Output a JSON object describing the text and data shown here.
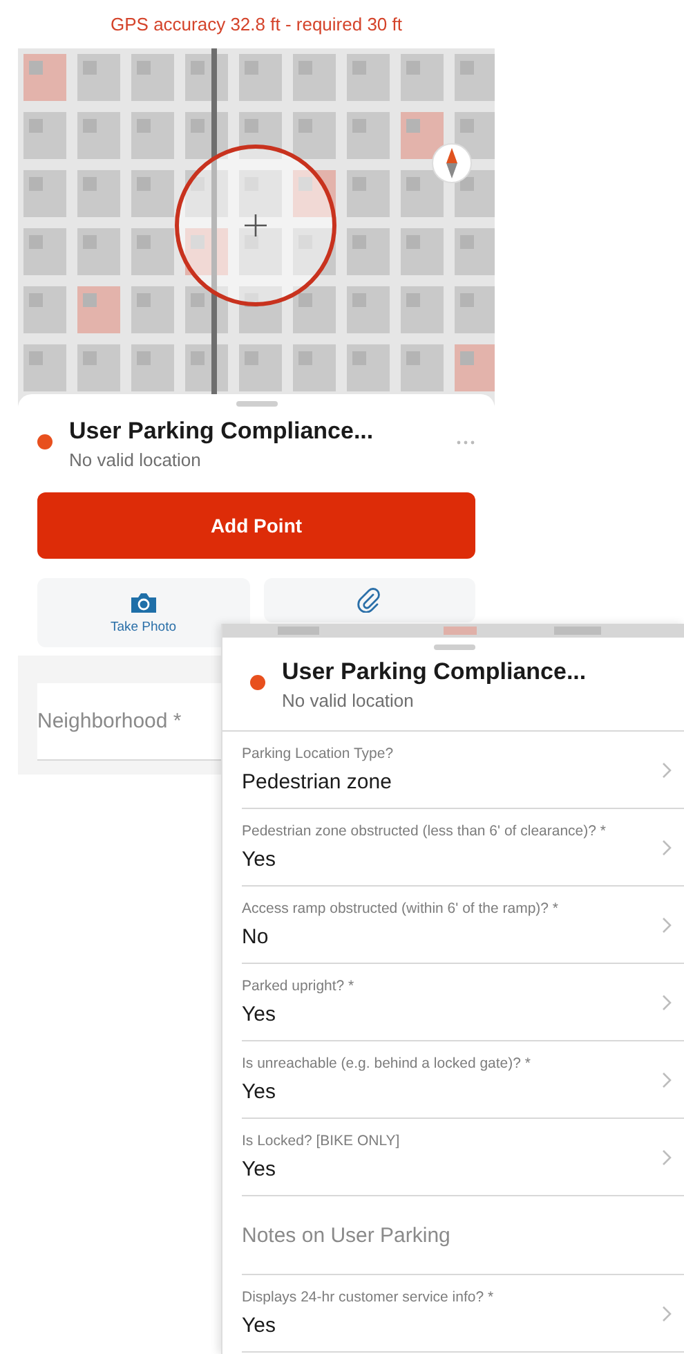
{
  "collect_screen": {
    "gps_banner": "GPS accuracy 32.8 ft - required 30 ft",
    "sheet": {
      "title": "User Parking Compliance...",
      "subtitle": "No valid location"
    },
    "add_button": "Add Point",
    "tiles": [
      {
        "kind": "camera",
        "label": "Take Photo"
      },
      {
        "kind": "attachment"
      }
    ],
    "fields": [
      {
        "kind": "text",
        "placeholder": "Neighborhood *"
      }
    ]
  },
  "form_screen": {
    "sheet": {
      "title": "User Parking Compliance...",
      "subtitle": "No valid location"
    },
    "fields": [
      {
        "kind": "choice",
        "label": "Parking Location Type?",
        "value": "Pedestrian zone"
      },
      {
        "kind": "choice",
        "label": "Pedestrian zone obstructed (less than 6' of clearance)? *",
        "value": "Yes"
      },
      {
        "kind": "choice",
        "label": "Access ramp obstructed (within 6' of the ramp)? *",
        "value": "No"
      },
      {
        "kind": "choice",
        "label": "Parked upright? *",
        "value": "Yes"
      },
      {
        "kind": "choice",
        "label": "Is unreachable (e.g. behind a locked gate)? *",
        "value": "Yes"
      },
      {
        "kind": "choice",
        "label": "Is Locked? [BIKE ONLY]",
        "value": "Yes"
      },
      {
        "kind": "text",
        "placeholder": "Notes on User Parking"
      },
      {
        "kind": "choice",
        "label": "Displays 24-hr customer service info? *",
        "value": "Yes"
      }
    ]
  }
}
